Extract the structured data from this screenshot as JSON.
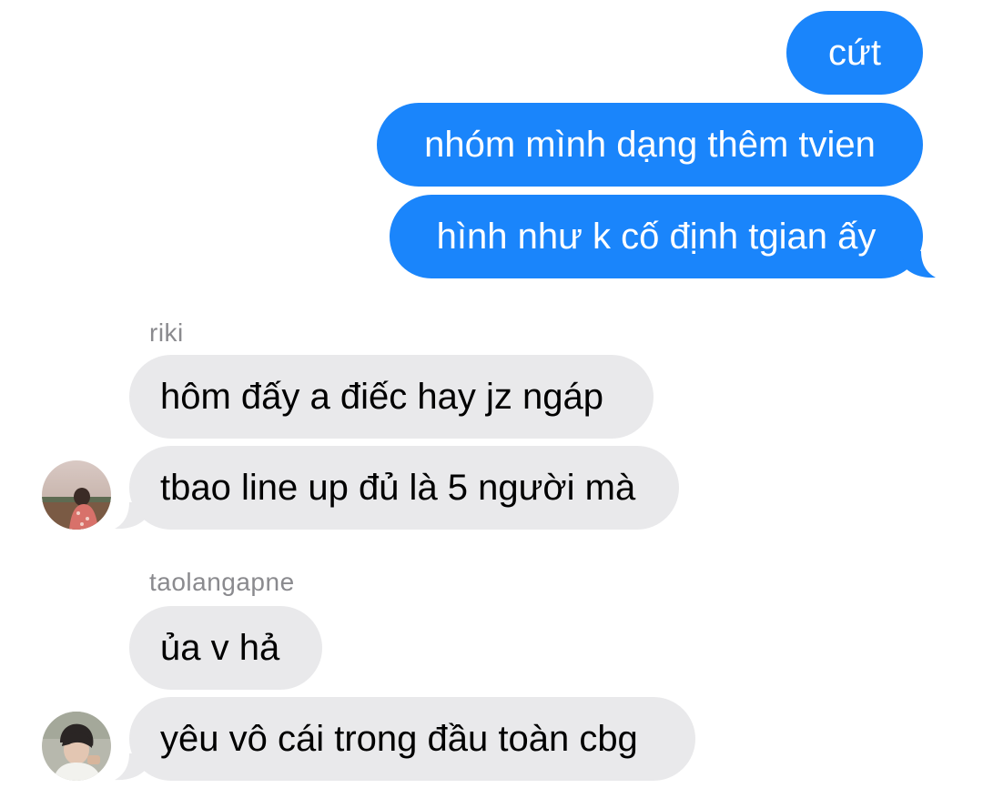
{
  "conversation": {
    "outgoing": [
      {
        "text": "cứt"
      },
      {
        "text": "nhóm mình dạng thêm tvien"
      },
      {
        "text": "hình như k cố định tgian ấy"
      }
    ],
    "groups": [
      {
        "sender": "riki",
        "messages": [
          {
            "text": "hôm đấy a điếc hay jz ngáp"
          },
          {
            "text": "tbao line up đủ là 5 người mà"
          }
        ]
      },
      {
        "sender": "taolangapne",
        "messages": [
          {
            "text": "ủa v hả"
          },
          {
            "text": "yêu vô cái trong đầu toàn cbg"
          }
        ]
      }
    ]
  },
  "colors": {
    "outgoing_bubble": "#1a85fb",
    "incoming_bubble": "#e9e9eb",
    "sender_name": "#8a8a8e"
  }
}
